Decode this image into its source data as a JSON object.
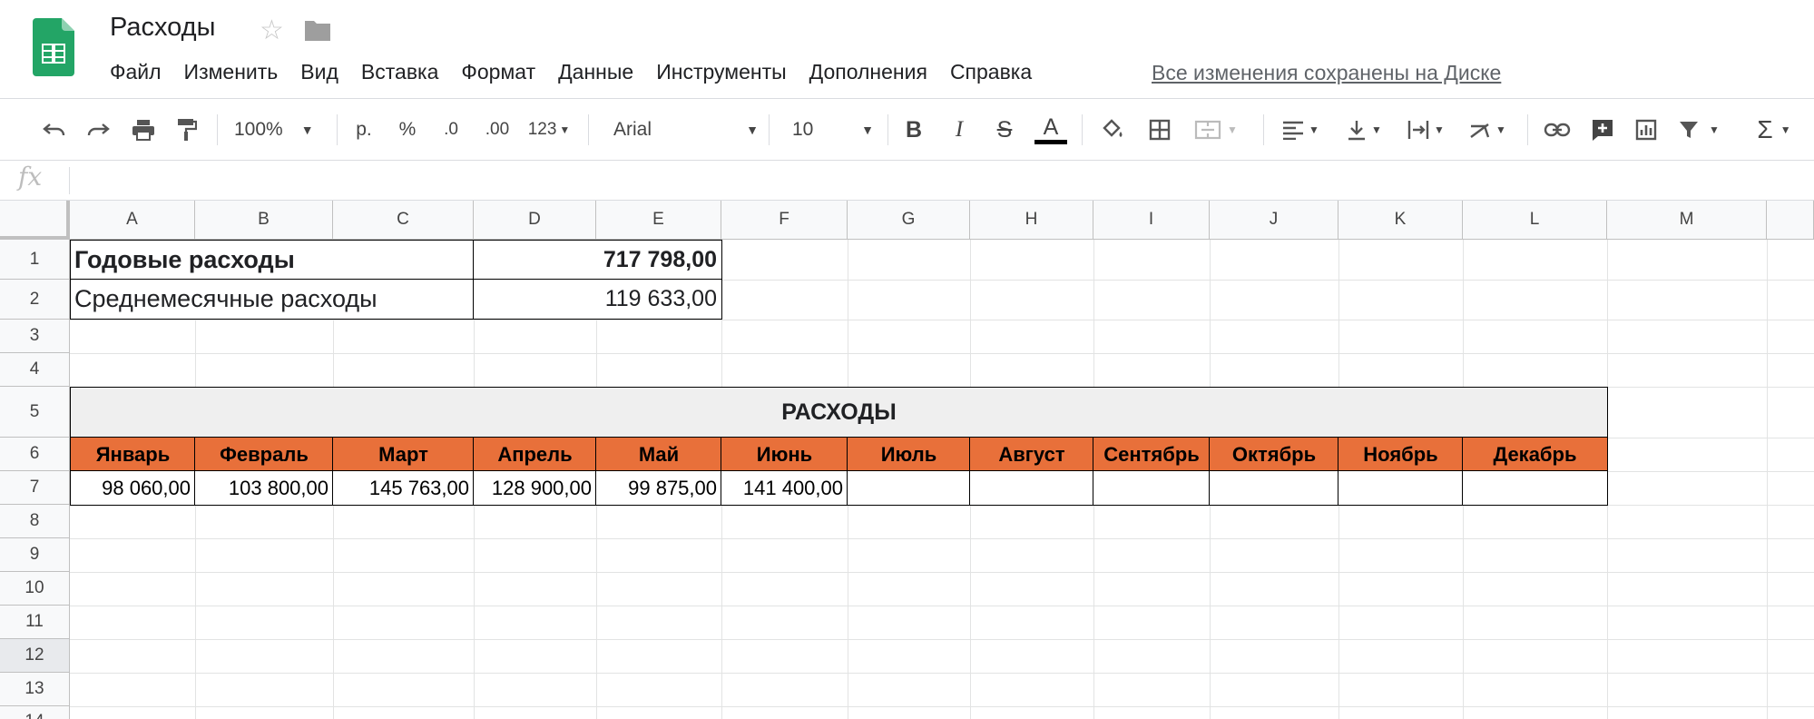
{
  "header": {
    "doc_title": "Расходы",
    "save_status": "Все изменения сохранены на Диске",
    "menu": [
      "Файл",
      "Изменить",
      "Вид",
      "Вставка",
      "Формат",
      "Данные",
      "Инструменты",
      "Дополнения",
      "Справка"
    ]
  },
  "toolbar": {
    "zoom": "100%",
    "currency": "р.",
    "percent": "%",
    "decrease_decimals": ".0",
    "increase_decimals": ".00",
    "more_formats": "123",
    "font": "Arial",
    "font_size": "10",
    "bold": "B",
    "italic": "I",
    "strikethrough": "S",
    "text_color": "A",
    "sum": "Σ"
  },
  "formula_bar": {
    "label": "fx",
    "value": ""
  },
  "grid": {
    "columns": [
      "A",
      "B",
      "C",
      "D",
      "E",
      "F",
      "G",
      "H",
      "I",
      "J",
      "K",
      "L",
      "M"
    ],
    "rows": [
      "1",
      "2",
      "3",
      "4",
      "5",
      "6",
      "7",
      "8",
      "9",
      "10",
      "11",
      "12",
      "13",
      "14"
    ]
  },
  "sheet": {
    "annual_label": "Годовые расходы",
    "annual_value": "717 798,00",
    "monthly_avg_label": "Среднемесячные расходы",
    "monthly_avg_value": "119 633,00",
    "table_title": "РАСХОДЫ",
    "months": [
      "Январь",
      "Февраль",
      "Март",
      "Апрель",
      "Май",
      "Июнь",
      "Июль",
      "Август",
      "Сентябрь",
      "Октябрь",
      "Ноябрь",
      "Декабрь"
    ],
    "values": [
      "98 060,00",
      "103 800,00",
      "145 763,00",
      "128 900,00",
      "99 875,00",
      "141 400,00",
      "",
      "",
      "",
      "",
      "",
      ""
    ]
  },
  "colors": {
    "header_orange": "#e8703a",
    "title_gray": "#efefef",
    "sheets_green": "#0f9d58"
  }
}
